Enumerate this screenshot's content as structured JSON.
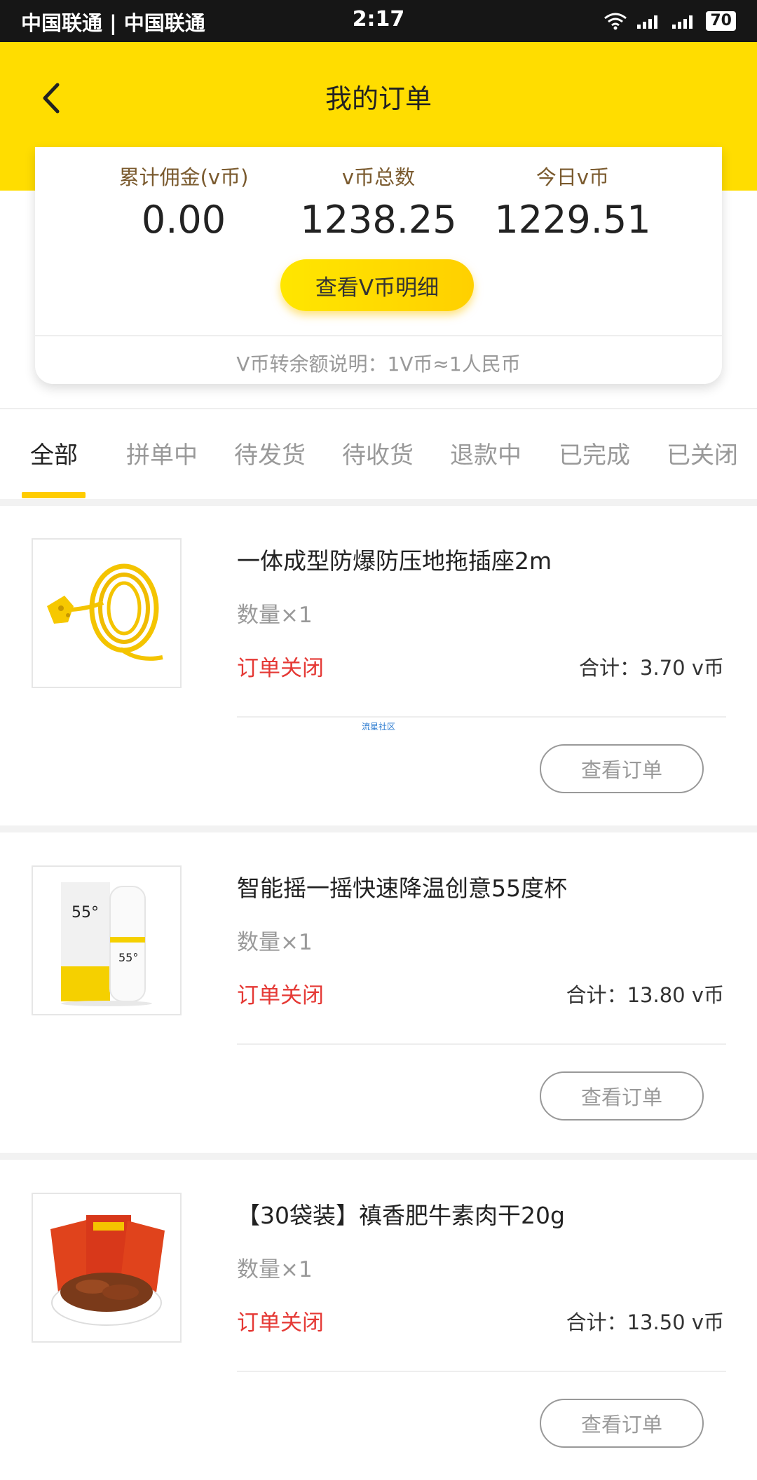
{
  "status_bar": {
    "carrier": "中国联通 | 中国联通",
    "time": "2:17",
    "battery": "70"
  },
  "header": {
    "title": "我的订单"
  },
  "summary": {
    "stats": [
      {
        "label": "累计佣金(v币)",
        "value": "0.00"
      },
      {
        "label": "v币总数",
        "value": "1238.25"
      },
      {
        "label": "今日v币",
        "value": "1229.51"
      }
    ],
    "detail_button": "查看V币明细",
    "note": "V币转余额说明：1V币≈1人民币"
  },
  "tabs": [
    "全部",
    "拼单中",
    "待发货",
    "待收货",
    "退款中",
    "已完成",
    "已关闭"
  ],
  "watermark": "流星社区",
  "orders": [
    {
      "name": "一体成型防爆防压地拖插座2m",
      "qty": "数量×1",
      "status": "订单关闭",
      "total": "合计：3.70 v币",
      "button": "查看订单",
      "icon": "extension-cord-image"
    },
    {
      "name": "智能摇一摇快速降温创意55度杯",
      "qty": "数量×1",
      "status": "订单关闭",
      "total": "合计：13.80 v币",
      "button": "查看订单",
      "icon": "cup-55-image",
      "cup_label": "55°"
    },
    {
      "name": "【30袋装】禛香肥牛素肉干20g",
      "qty": "数量×1",
      "status": "订单关闭",
      "total": "合计：13.50 v币",
      "button": "查看订单",
      "icon": "beef-jerky-image"
    }
  ]
}
